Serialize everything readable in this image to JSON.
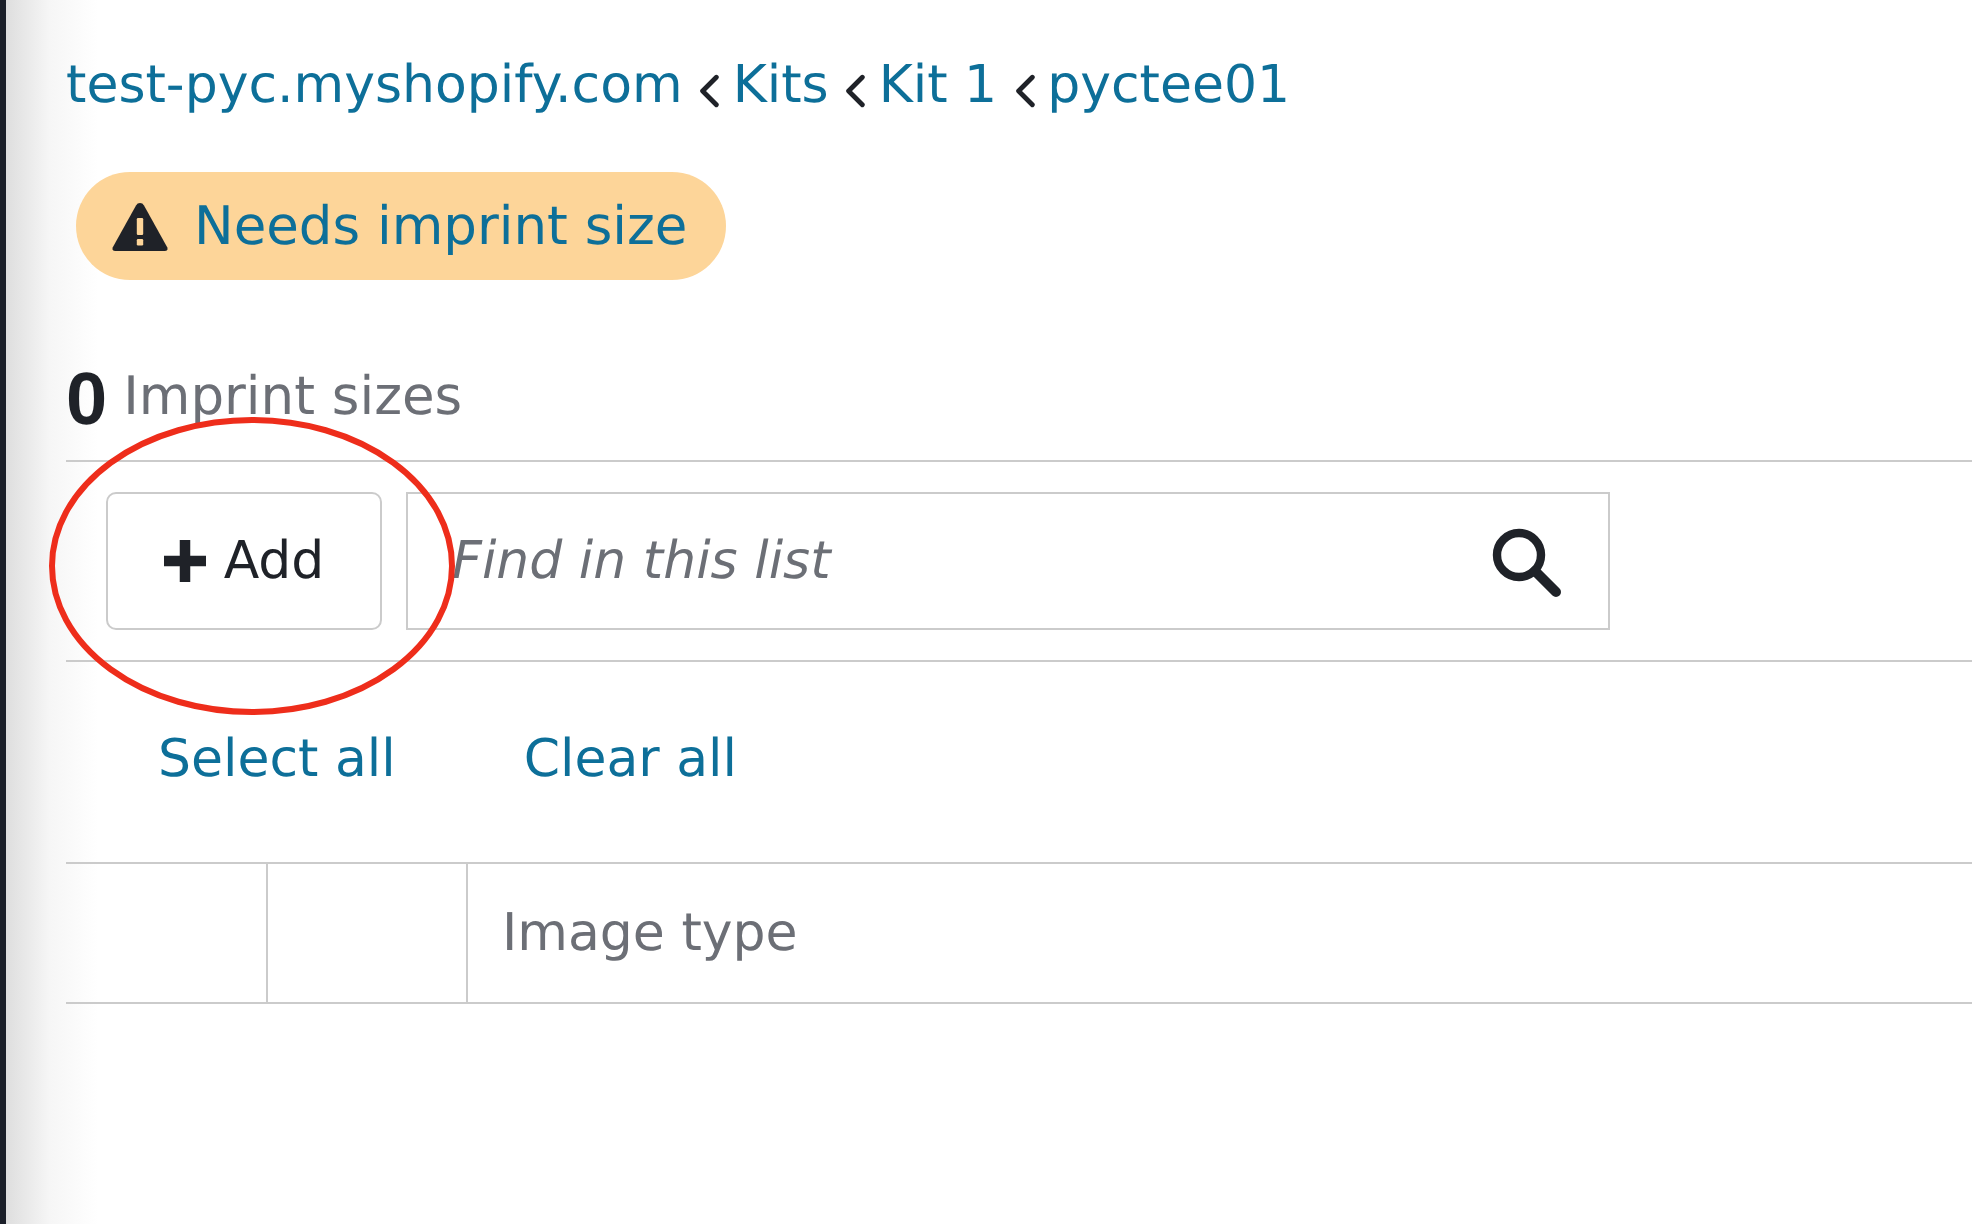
{
  "breadcrumb": [
    {
      "label": "test-pyc.myshopify.com"
    },
    {
      "label": "Kits"
    },
    {
      "label": "Kit 1"
    },
    {
      "label": "pyctee01"
    }
  ],
  "status_badge": {
    "kind": "warning",
    "text": "Needs imprint size"
  },
  "list_header": {
    "count": "0",
    "title": "Imprint sizes"
  },
  "toolbar": {
    "add_button": "Add",
    "search": {
      "placeholder": "Find in this list"
    }
  },
  "selection_links": [
    "Select all",
    "Clear all"
  ],
  "table": {
    "columns": [
      {
        "kind": "blank"
      },
      {
        "kind": "blank"
      },
      {
        "kind": "text",
        "label": "Image type"
      }
    ]
  },
  "annotation": {
    "kind": "ellipse"
  }
}
